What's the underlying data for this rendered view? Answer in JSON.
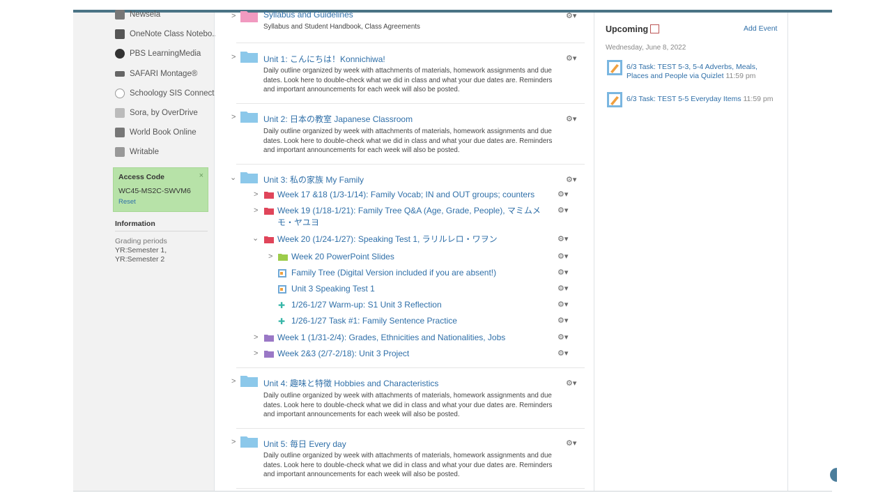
{
  "sidebar": {
    "apps": [
      {
        "label": "Newsela",
        "icon": "newsela-icon",
        "color": "#777777"
      },
      {
        "label": "OneNote Class Notebo...",
        "icon": "onenote-icon",
        "color": "#555555"
      },
      {
        "label": "PBS LearningMedia",
        "icon": "pbs-icon",
        "color": "#333333"
      },
      {
        "label": "SAFARI Montage®",
        "icon": "safari-montage-icon",
        "color": "#666666"
      },
      {
        "label": "Schoology SIS Connect",
        "icon": "sis-icon",
        "color": "#999999"
      },
      {
        "label": "Sora, by OverDrive",
        "icon": "sora-icon",
        "color": "#888888"
      },
      {
        "label": "World Book Online",
        "icon": "worldbook-icon",
        "color": "#666666"
      },
      {
        "label": "Writable",
        "icon": "writable-icon",
        "color": "#888888"
      }
    ],
    "access_code": {
      "title": "Access Code",
      "code": "WC45-MS2C-SWVM6",
      "reset": "Reset",
      "close": "×"
    },
    "information": {
      "title": "Information",
      "grading_label": "Grading periods",
      "grading_value": "YR:Semester 1, YR:Semester 2"
    }
  },
  "main": {
    "gear_glyph": "⚙▾",
    "units": [
      {
        "title": "Syllabus and Guidelines",
        "desc": "Syllabus and Student Handbook, Class Agreements",
        "expanded": false,
        "folder_color": "#f19ac0"
      },
      {
        "title": "Unit 1: こんにちは！Konnichiwa!",
        "desc": "Daily outline organized by week with attachments of materials, homework assignments and due dates. Look here to double-check what we did in class and what your due dates are. Reminders and important announcements for each week will also be posted.",
        "expanded": false,
        "folder_color": "#8cc8ea"
      },
      {
        "title": "Unit 2: 日本の教室 Japanese Classroom",
        "desc": "Daily outline organized by week with attachments of materials, homework assignments and due dates. Look here to double-check what we did in class and what your due dates are. Reminders and important announcements for each week will also be posted.",
        "expanded": false,
        "folder_color": "#8cc8ea"
      },
      {
        "title": "Unit 3: 私の家族 My Family",
        "expanded": true,
        "folder_color": "#8cc8ea"
      },
      {
        "title": "Unit 4: 趣味と特徴 Hobbies and Characteristics",
        "desc": "Daily outline organized by week with attachments of materials, homework assignments and due dates. Look here to double-check what we did in class and what your due dates are. Reminders and important announcements for each week will also be posted.",
        "expanded": false,
        "folder_color": "#8cc8ea"
      },
      {
        "title": "Unit 5: 毎日 Every day",
        "desc": "Daily outline organized by week with attachments of materials, homework assignments and due dates. Look here to double-check what we did in class and what your due dates are. Reminders and important announcements for each week will also be posted.",
        "expanded": false,
        "folder_color": "#8cc8ea"
      }
    ],
    "unit3_children": [
      {
        "title": "Week 17 &18 (1/3-1/14): Family Vocab; IN and OUT groups; counters",
        "type": "folder",
        "color": "#e0455a"
      },
      {
        "title": "Week 19 (1/18-1/21): Family Tree Q&A (Age, Grade, People), マミムメ",
        "title2": "モ・ヤユヨ",
        "type": "folder",
        "color": "#e0455a"
      },
      {
        "title": "Week 20 (1/24-1/27): Speaking Test 1, ラリルレロ・ワヲン",
        "type": "folder",
        "color": "#e0455a",
        "expanded": true
      },
      {
        "title": "Week 20 PowerPoint Slides",
        "type": "folder",
        "color": "#9ccc4a"
      },
      {
        "title": "Family Tree (Digital Version included if you are absent!)",
        "type": "assignment"
      },
      {
        "title": "Unit 3 Speaking Test 1",
        "type": "assignment"
      },
      {
        "title": "1/26-1/27 Warm-up: S1 Unit 3 Reflection",
        "type": "puzzle"
      },
      {
        "title": "1/26-1/27 Task #1: Family Sentence Practice",
        "type": "puzzle"
      },
      {
        "title": "Week 1 (1/31-2/4): Grades, Ethnicities and Nationalities, Jobs",
        "type": "folder",
        "color": "#9a78c6"
      },
      {
        "title": "Week 2&3 (2/7-2/18): Unit 3 Project",
        "type": "folder",
        "color": "#9a78c6"
      }
    ]
  },
  "upcoming": {
    "title": "Upcoming ·",
    "add_event": "Add Event",
    "date": "Wednesday, June 8, 2022",
    "tasks": [
      {
        "title": "6/3 Task: TEST 5-3, 5-4 Adverbs, Meals, Places and People via Quizlet",
        "time": "11:59 pm"
      },
      {
        "title": "6/3 Task: TEST 5-5 Everyday Items",
        "time": "11:59 pm"
      }
    ]
  }
}
